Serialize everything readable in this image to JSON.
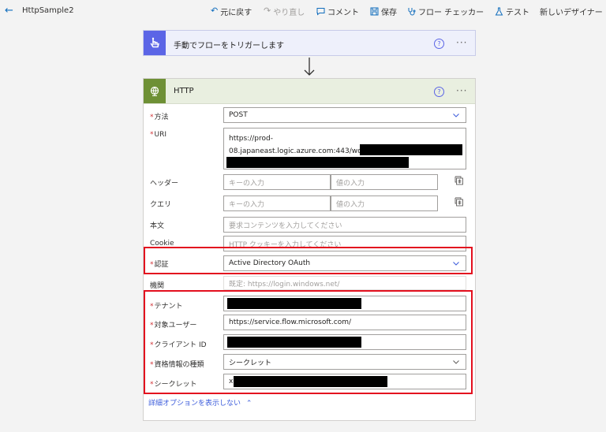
{
  "app": {
    "title": "HttpSample2"
  },
  "toolbar": {
    "undo": "元に戻す",
    "redo": "やり直し",
    "comment": "コメント",
    "save": "保存",
    "flow_checker": "フロー チェッカー",
    "test": "テスト",
    "new_designer": "新しいデザイナー"
  },
  "trigger": {
    "title": "手動でフローをトリガーします"
  },
  "http": {
    "title": "HTTP",
    "fields": {
      "method": {
        "label": "方法",
        "value": "POST"
      },
      "uri": {
        "label": "URI",
        "line1": "https://prod-",
        "line2": "08.japaneast.logic.azure.com:443/workflows/"
      },
      "headers": {
        "label": "ヘッダー",
        "key_placeholder": "キーの入力",
        "value_placeholder": "値の入力"
      },
      "queries": {
        "label": "クエリ",
        "key_placeholder": "キーの入力",
        "value_placeholder": "値の入力"
      },
      "body": {
        "label": "本文",
        "placeholder": "要求コンテンツを入力してください"
      },
      "cookie": {
        "label": "Cookie",
        "placeholder": "HTTP クッキーを入力してください"
      },
      "auth": {
        "label": "認証",
        "value": "Active Directory OAuth"
      },
      "authority": {
        "label": "機関",
        "placeholder": "既定: https://login.windows.net/"
      },
      "tenant": {
        "label": "テナント"
      },
      "audience": {
        "label": "対象ユーザー",
        "value": "https://service.flow.microsoft.com/"
      },
      "client_id": {
        "label": "クライアント ID"
      },
      "credential_type": {
        "label": "資格情報の種類",
        "value": "シークレット"
      },
      "secret": {
        "label": "シークレット",
        "prefix": "x"
      }
    },
    "advanced_link": "詳細オプションを表示しない"
  },
  "colors": {
    "accent": "#0f6cbd",
    "trigger_badge": "#5b65e6",
    "http_badge": "#6e9035",
    "highlight": "#e30f1e"
  }
}
